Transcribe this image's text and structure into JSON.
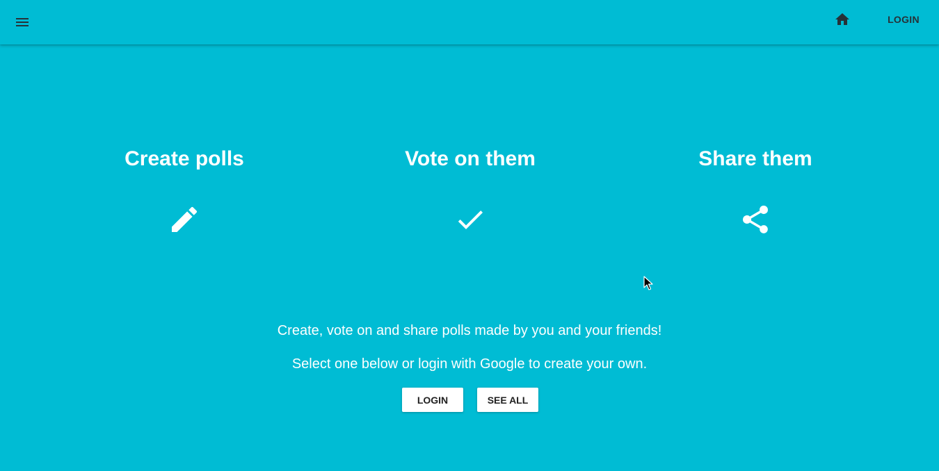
{
  "topbar": {
    "menu_icon": "menu-icon",
    "home_icon": "home-icon",
    "login_label": "LOGIN"
  },
  "features": [
    {
      "title": "Create polls",
      "icon": "pencil-icon"
    },
    {
      "title": "Vote on them",
      "icon": "check-icon"
    },
    {
      "title": "Share them",
      "icon": "share-icon"
    }
  ],
  "intro": {
    "line1": "Create, vote on and share polls made by you and your friends!",
    "line2": "Select one below or login with Google to create your own."
  },
  "actions": {
    "login_label": "LOGIN",
    "see_all_label": "SEE ALL"
  },
  "colors": {
    "background": "#00BCD4",
    "button_bg": "#ffffff",
    "topbar_link": "#263238"
  }
}
